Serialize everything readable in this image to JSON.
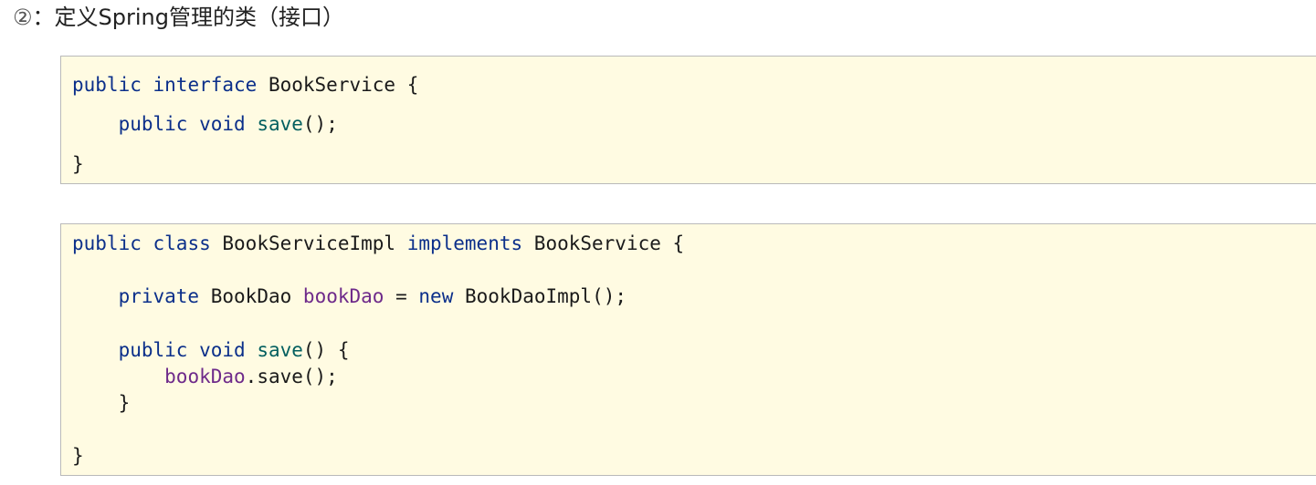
{
  "heading": {
    "number": "②",
    "text": "：定义Spring管理的类（接口）"
  },
  "interface_block": {
    "line1": {
      "kw1": "public",
      "kw2": "interface",
      "name": "BookService",
      "brace": "{"
    },
    "line2": {
      "kw1": "public",
      "kw2": "void",
      "method": "save",
      "rest": "();"
    },
    "line3": {
      "text": "}"
    }
  },
  "impl_block": {
    "line1": {
      "kw1": "public",
      "kw2": "class",
      "name": "BookServiceImpl",
      "kw3": "implements",
      "iface": "BookService",
      "brace": "{"
    },
    "line2": {
      "kw1": "private",
      "type": "BookDao",
      "field": "bookDao",
      "eq": "=",
      "kw2": "new",
      "rest": "BookDaoImpl();"
    },
    "line3": {
      "kw1": "public",
      "kw2": "void",
      "method": "save",
      "rest": "() {"
    },
    "line4": {
      "field": "bookDao",
      "rest": ".save();"
    },
    "line5": {
      "text": "}"
    },
    "line6": {
      "text": "}"
    }
  },
  "colors": {
    "background": "#fffbe2",
    "border": "#b9b9b9",
    "keyword": "#0b2f8a",
    "method": "#035f5f",
    "field": "#6e2a8a"
  }
}
